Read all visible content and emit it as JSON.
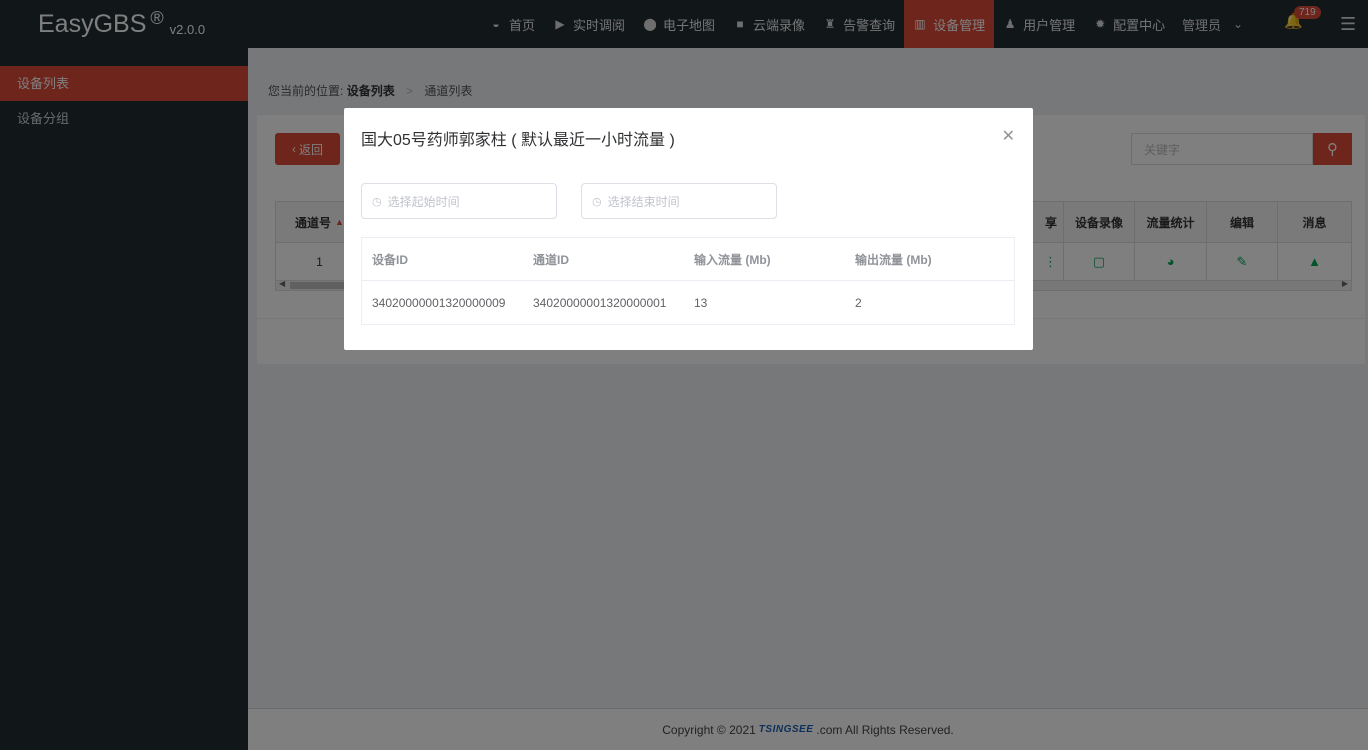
{
  "brand": {
    "name": "EasyGBS",
    "reg": "®",
    "version": "v2.0.0"
  },
  "nav": [
    {
      "icon": "dashboard-icon",
      "glyph": "◒",
      "label": "首页"
    },
    {
      "icon": "play-icon",
      "glyph": "▶",
      "label": "实时调阅"
    },
    {
      "icon": "map-pin-icon",
      "glyph": "⬤",
      "label": "电子地图"
    },
    {
      "icon": "video-camera-icon",
      "glyph": "■",
      "label": "云端录像"
    },
    {
      "icon": "alarm-icon",
      "glyph": "♜",
      "label": "告警查询"
    },
    {
      "icon": "device-icon",
      "glyph": "▥",
      "label": "设备管理"
    },
    {
      "icon": "user-icon",
      "glyph": "♟",
      "label": "用户管理"
    },
    {
      "icon": "gear-icon",
      "glyph": "✹",
      "label": "配置中心"
    }
  ],
  "user": {
    "label": "管理员"
  },
  "notifications": {
    "count": "719"
  },
  "sidebar": {
    "items": [
      {
        "label": "设备列表"
      },
      {
        "label": "设备分组"
      }
    ]
  },
  "breadcrumb": {
    "prefix": "您当前的位置:",
    "current": "设备列表",
    "next": "通道列表"
  },
  "toolbar": {
    "back_label": "返回",
    "search_placeholder": "关键字"
  },
  "table": {
    "col_first": "通道号",
    "col_share_tail": "享",
    "cols_right": [
      "设备录像",
      "流量统计",
      "编辑",
      "消息"
    ],
    "row_first": "1"
  },
  "modal": {
    "title": "国大05号药师郭家柱 ( 默认最近一小时流量 )",
    "start_placeholder": "选择起始时间",
    "end_placeholder": "选择结束时间",
    "headers": [
      "设备ID",
      "通道ID",
      "输入流量 (Mb)",
      "输出流量 (Mb)"
    ],
    "rows": [
      [
        "34020000001320000009",
        "34020000001320000001",
        "13",
        "2"
      ]
    ]
  },
  "footer": {
    "before": "Copyright © 2021",
    "logo": "TSINGSEE",
    "after": ".com All Rights Reserved."
  },
  "colors": {
    "accent": "#dd4b39",
    "topbar": "#222d32",
    "icon_green": "#00a65a"
  }
}
